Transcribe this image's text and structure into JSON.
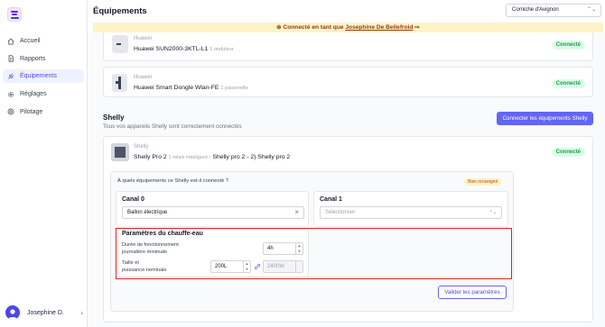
{
  "sidebar": {
    "items": [
      {
        "label": "Accueil",
        "icon": "home-icon"
      },
      {
        "label": "Rapports",
        "icon": "document-icon"
      },
      {
        "label": "Équipements",
        "icon": "plug-icon"
      },
      {
        "label": "Réglages",
        "icon": "gear-icon"
      },
      {
        "label": "Pilotage",
        "icon": "target-icon"
      }
    ],
    "active_index": 2,
    "user": {
      "name": "Josephine D.",
      "chevron": "›"
    }
  },
  "header": {
    "title": "Équipements",
    "site_select": {
      "value": "Corniche d'Avignon",
      "chevron": "⌃⌄"
    }
  },
  "banner": {
    "prefix": "Connecté en tant que",
    "user": "Josephine De Bellefroid",
    "icon": "user-switch-icon"
  },
  "huawei_devices": [
    {
      "brand": "Huawei",
      "name": "Huawei SUN2000-3KTL-L1",
      "meta": "1 onduleur",
      "status": "Connecté"
    },
    {
      "brand": "Huawei",
      "name": "Huawei Smart Dongle Wlan-FE",
      "meta": "1 passerelle",
      "status": "Connecté"
    }
  ],
  "shelly": {
    "title": "Shelly",
    "subtitle": "Tous vos appareils Shelly sont correctement connectés",
    "connect_button": "Connecter les équipements Shelly",
    "device": {
      "brand": "Shelly",
      "name": "Shelly Pro 2",
      "meta": "1 relais intelligent",
      "separator": "›",
      "alias": "Shelly pro 2 - 2) Shelly pro 2",
      "status": "Connecté"
    },
    "question": "À quels équipements ce Shelly est-il connecté ?",
    "question_badge": "Bien renseigné",
    "canal0": {
      "title": "Canal 0",
      "value": "Ballon électrique",
      "clear": "×"
    },
    "canal1": {
      "title": "Canal 1",
      "placeholder": "Sélectionner",
      "chevron": "⌃⌄"
    },
    "params": {
      "title": "Paramètres du chauffe-eau",
      "duration_label_1": "Durée de fonctionnement",
      "duration_label_2": "journalière minimale",
      "duration_value": "4h",
      "size_label_1": "Taille et",
      "size_label_2": "puissance nominale",
      "size_value": "200L",
      "power_value": "2400W"
    },
    "validate_button": "Valider les paramètres"
  },
  "colors": {
    "accent": "#6366f1",
    "success": "#16a34a",
    "warning_bg": "#fef3c7",
    "highlight": "#dc2626"
  }
}
